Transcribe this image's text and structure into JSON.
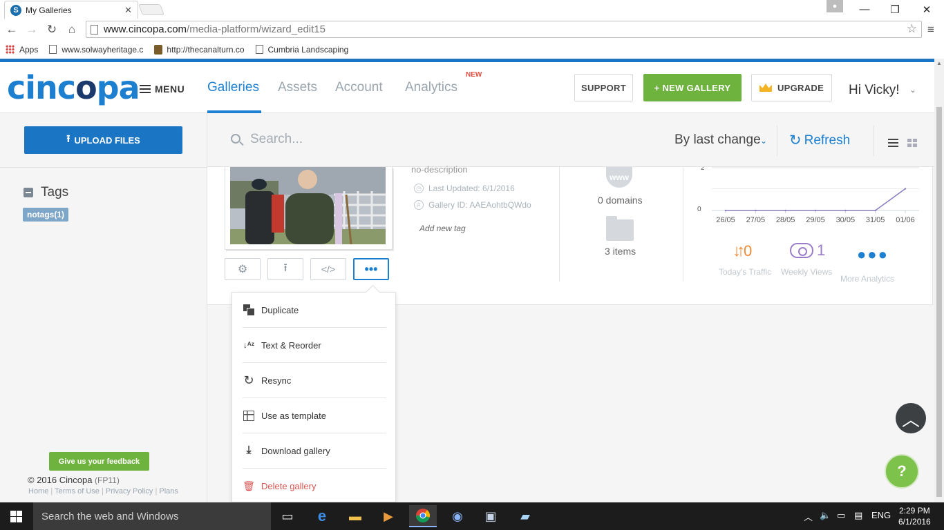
{
  "browser": {
    "tab_title": "My Galleries",
    "tab_favicon": "cincopa-favicon",
    "url_host": "www.cincopa.com",
    "url_path": "/media-platform/wizard_edit15",
    "bookmarks": [
      {
        "label": "Apps"
      },
      {
        "label": "www.solwayheritage.c"
      },
      {
        "label": "http://thecanalturn.co"
      },
      {
        "label": "Cumbria Landscaping"
      }
    ]
  },
  "header": {
    "logo": "cincopa",
    "menu_label": "MENU",
    "nav": [
      {
        "label": "Galleries",
        "active": true
      },
      {
        "label": "Assets"
      },
      {
        "label": "Account"
      },
      {
        "label": "Analytics"
      }
    ],
    "analytics_badge": "NEW",
    "support_label": "SUPPORT",
    "new_gallery_label": "+ NEW GALLERY",
    "upgrade_label": "UPGRADE",
    "greeting": "Hi Vicky!",
    "accent_color": "#1d7fd0",
    "green_color": "#6fb33f"
  },
  "sidebar": {
    "upload_label": "UPLOAD FILES",
    "tags_title": "Tags",
    "tag_chip": "notags(1)",
    "feedback_label": "Give us your feedback",
    "copyright": "© 2016 Cincopa",
    "fp_code": "(FP11)",
    "footer_links": [
      "Home",
      "Terms of Use",
      "Privacy Policy",
      "Plans"
    ]
  },
  "toolbar": {
    "search_placeholder": "Search...",
    "sort_label": "By last change",
    "refresh_label": "Refresh"
  },
  "gallery": {
    "description": "no-description",
    "last_updated": "Last Updated: 6/1/2016",
    "gallery_id": "Gallery ID: AAEAohtbQWdo",
    "add_tag": "Add new tag",
    "www_label": "www",
    "domains": "0 domains",
    "items": "3 items",
    "todays_traffic_value": "0",
    "todays_traffic_label": "Today's Traffic",
    "weekly_views_value": "1",
    "weekly_views_label": "Weekly Views",
    "more_analytics_label": "More Analytics"
  },
  "chart_data": {
    "type": "line",
    "categories": [
      "26/05",
      "27/05",
      "28/05",
      "29/05",
      "30/05",
      "31/05",
      "01/06"
    ],
    "y_ticks": [
      "2",
      "0"
    ],
    "ylim": [
      0,
      2
    ],
    "values": [
      0,
      0,
      0,
      0,
      0,
      0,
      1
    ],
    "line_color": "#8a7cc0"
  },
  "dropdown": {
    "items": [
      {
        "label": "Duplicate",
        "icon": "duplicate-icon"
      },
      {
        "label": "Text & Reorder",
        "icon": "sort-az-icon"
      },
      {
        "label": "Resync",
        "icon": "resync-icon"
      },
      {
        "label": "Use as template",
        "icon": "template-icon"
      },
      {
        "label": "Download gallery",
        "icon": "download-icon"
      },
      {
        "label": "Delete gallery",
        "icon": "trash-icon"
      }
    ]
  },
  "taskbar": {
    "search_placeholder": "Search the web and Windows",
    "language": "ENG",
    "time": "2:29 PM",
    "date": "6/1/2016"
  }
}
